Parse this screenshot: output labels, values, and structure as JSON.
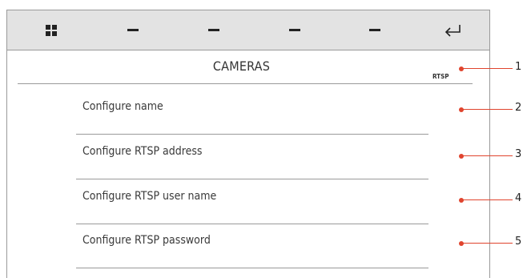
{
  "toolbar": {
    "items": [
      {
        "name": "grid-icon"
      },
      {
        "name": "minus-icon"
      },
      {
        "name": "minus-icon"
      },
      {
        "name": "minus-icon"
      },
      {
        "name": "minus-icon"
      },
      {
        "name": "back-arrow-icon"
      }
    ]
  },
  "screen": {
    "title": "CAMERAS",
    "badge": "RTSP"
  },
  "menu": [
    {
      "label": "Configure name"
    },
    {
      "label": "Configure RTSP address"
    },
    {
      "label": "Configure RTSP user name"
    },
    {
      "label": "Configure RTSP password"
    }
  ],
  "callouts": [
    "1",
    "2",
    "3",
    "4",
    "5"
  ],
  "colors": {
    "toolbar_bg": "#e3e3e3",
    "callout": "#e0442e",
    "divider": "#9a9a9a"
  }
}
